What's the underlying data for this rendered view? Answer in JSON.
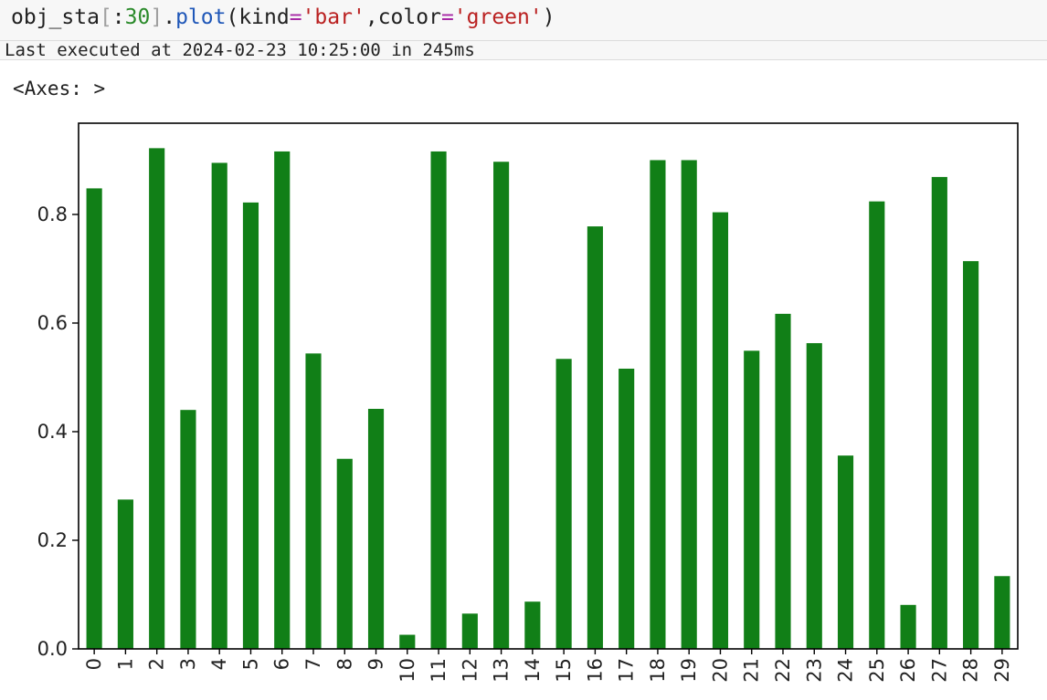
{
  "code": {
    "obj": "obj_sta",
    "bracket_open": "[",
    "slice": ":",
    "number": "30",
    "bracket_close": "]",
    "dot": ".",
    "method": "plot",
    "paren_open": "(",
    "kw1": "kind",
    "eq1": "=",
    "val1": "'bar'",
    "comma": ",",
    "kw2": "color",
    "eq2": "=",
    "val2": "'green'",
    "paren_close": ")"
  },
  "exec_info": "Last executed at 2024-02-23 10:25:00 in 245ms",
  "output_repr": "<Axes: >",
  "colors": {
    "bar": "#117f17",
    "axis": "#000000"
  },
  "chart_data": {
    "type": "bar",
    "categories": [
      "0",
      "1",
      "2",
      "3",
      "4",
      "5",
      "6",
      "7",
      "8",
      "9",
      "10",
      "11",
      "12",
      "13",
      "14",
      "15",
      "16",
      "17",
      "18",
      "19",
      "20",
      "21",
      "22",
      "23",
      "24",
      "25",
      "26",
      "27",
      "28",
      "29"
    ],
    "values": [
      0.848,
      0.275,
      0.922,
      0.44,
      0.895,
      0.822,
      0.916,
      0.544,
      0.35,
      0.442,
      0.026,
      0.916,
      0.065,
      0.897,
      0.087,
      0.534,
      0.778,
      0.516,
      0.9,
      0.9,
      0.804,
      0.549,
      0.617,
      0.563,
      0.356,
      0.824,
      0.081,
      0.869,
      0.714,
      0.134
    ],
    "yticks": [
      "0.0",
      "0.2",
      "0.4",
      "0.6",
      "0.8"
    ],
    "ytick_values": [
      0,
      0.2,
      0.4,
      0.6,
      0.8
    ],
    "ylim": [
      0,
      0.968
    ],
    "title": "",
    "xlabel": "",
    "ylabel": "",
    "grid": false,
    "legend": false
  }
}
